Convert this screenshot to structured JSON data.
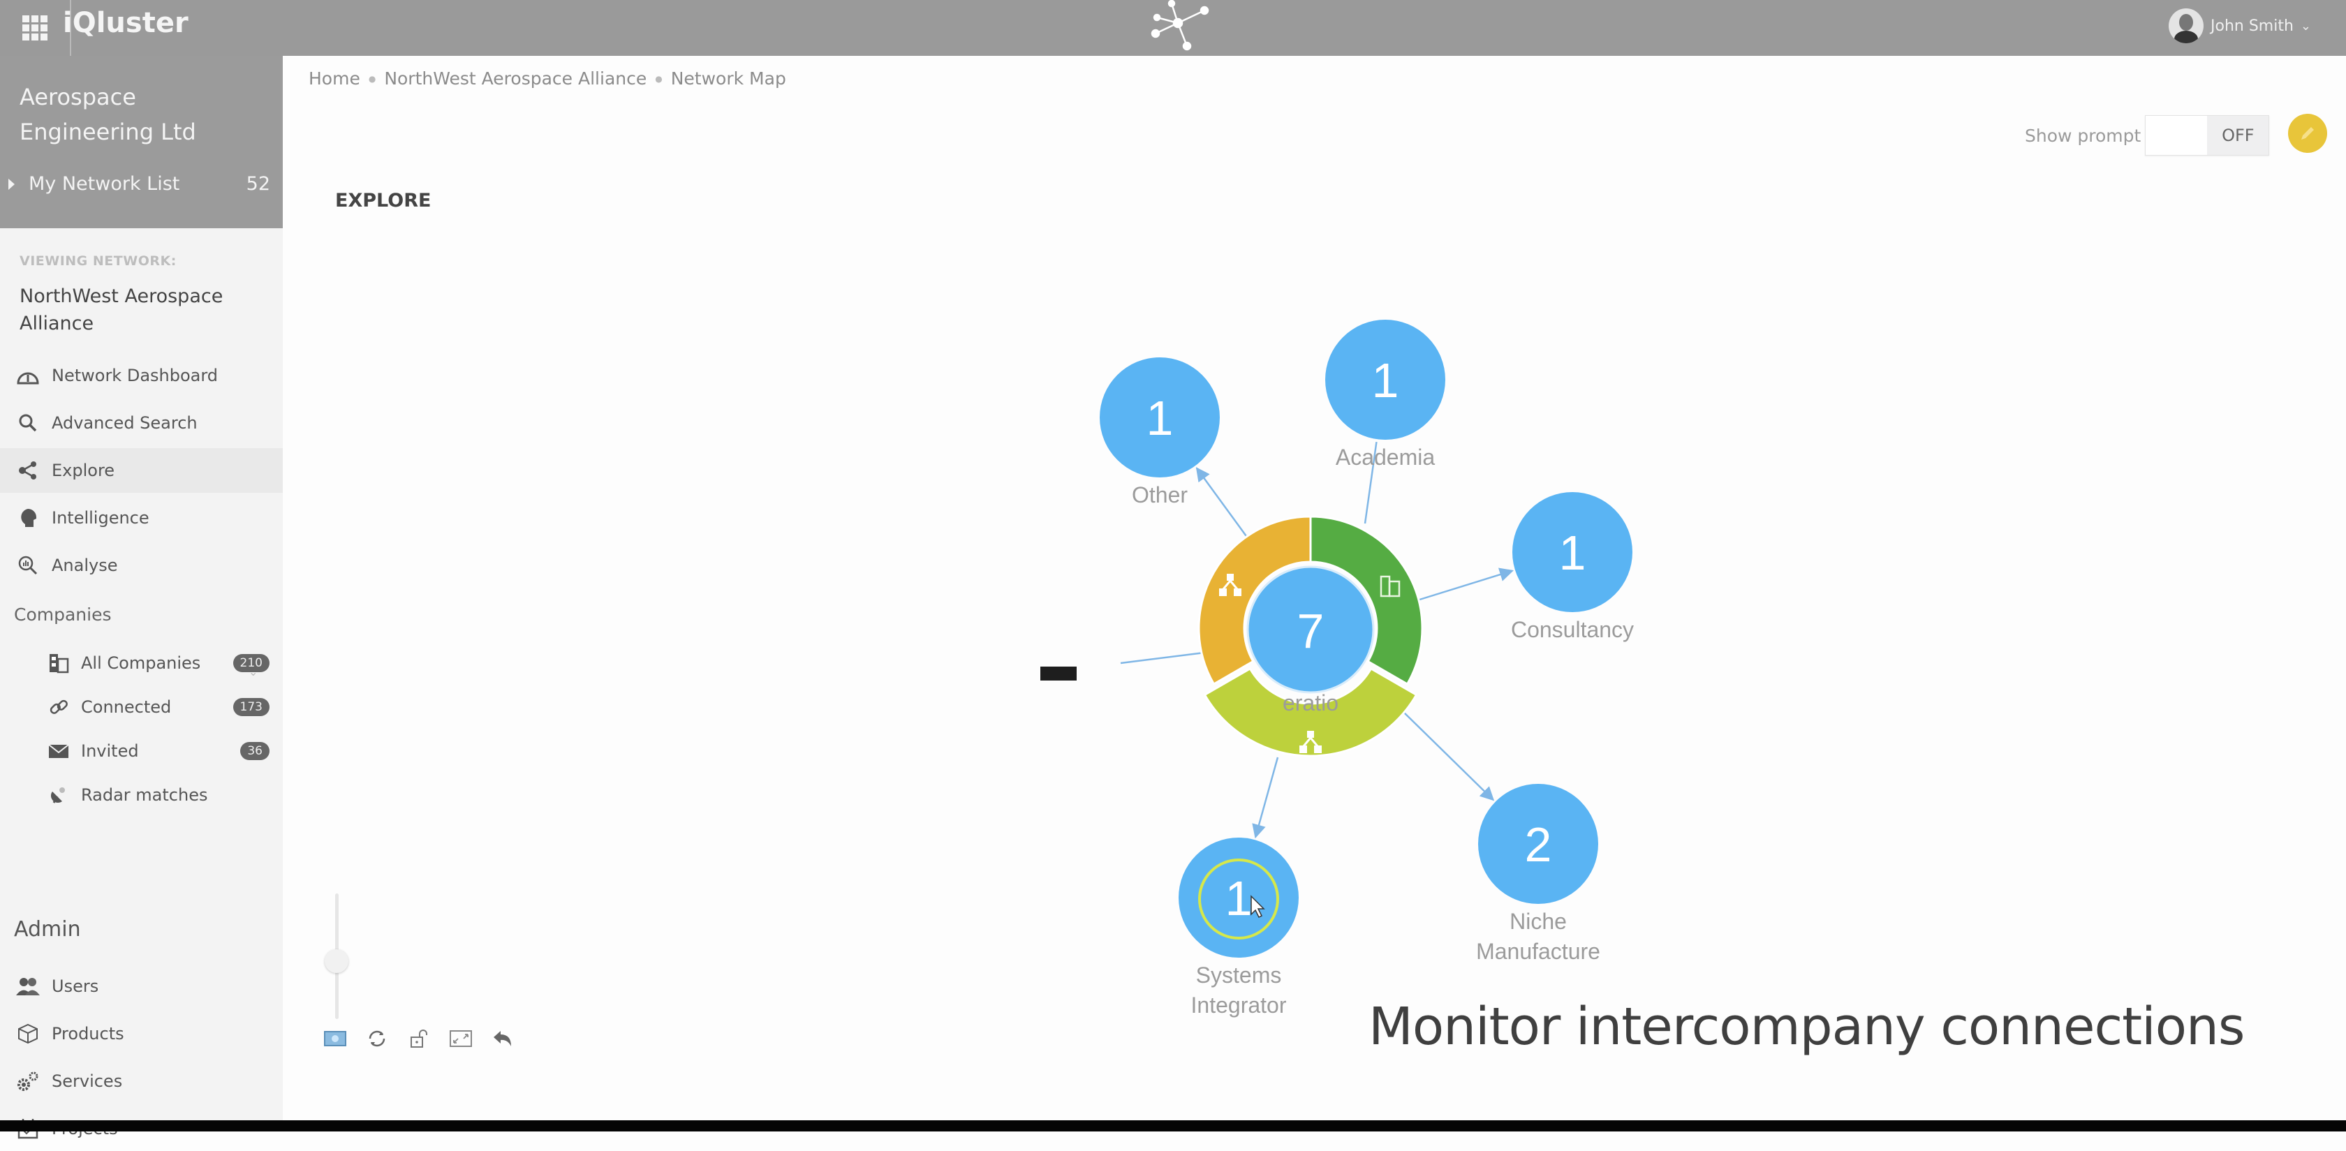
{
  "app": {
    "title": "iQluster",
    "user_name": "John Smith"
  },
  "sidebar": {
    "company": "Aerospace Engineering Ltd",
    "network_list": {
      "label": "My Network List",
      "count": "52"
    },
    "viewing_label": "VIEWING NETWORK:",
    "network_name": "NorthWest Aerospace Alliance",
    "nav": [
      {
        "label": "Network Dashboard",
        "icon": "dashboard-icon"
      },
      {
        "label": "Advanced Search",
        "icon": "search-icon"
      },
      {
        "label": "Explore",
        "icon": "share-icon",
        "active": true
      },
      {
        "label": "Intelligence",
        "icon": "brain-icon"
      },
      {
        "label": "Analyse",
        "icon": "analyse-icon"
      }
    ],
    "companies": {
      "label": "Companies",
      "items": [
        {
          "label": "All Companies",
          "count": "210",
          "icon": "buildings-icon"
        },
        {
          "label": "Connected",
          "count": "173",
          "icon": "link-icon"
        },
        {
          "label": "Invited",
          "count": "36",
          "icon": "envelope-icon"
        },
        {
          "label": "Radar matches",
          "icon": "radar-icon"
        }
      ]
    },
    "admin": {
      "label": "Admin",
      "items": [
        {
          "label": "Users",
          "icon": "users-icon"
        },
        {
          "label": "Products",
          "icon": "box-icon"
        },
        {
          "label": "Services",
          "icon": "gears-icon"
        },
        {
          "label": "Projects",
          "icon": "calendar-icon"
        }
      ]
    }
  },
  "breadcrumb": [
    "Home",
    "NorthWest Aerospace Alliance",
    "Network Map"
  ],
  "page_title": "EXPLORE",
  "prompt": {
    "label": "Show prompt",
    "state": "OFF"
  },
  "network_map": {
    "center": {
      "count": "7",
      "label_fragment": "eratio"
    },
    "ring_segments": [
      {
        "color": "#e8b234",
        "icon": "hierarchy-icon"
      },
      {
        "color": "#55ac43",
        "icon": "buildings-icon"
      },
      {
        "color": "#bdd13c",
        "icon": "hierarchy-icon"
      }
    ],
    "nodes": [
      {
        "label": "Other",
        "count": "1"
      },
      {
        "label": "Academia",
        "count": "1"
      },
      {
        "label": "Consultancy",
        "count": "1"
      },
      {
        "label": "Niche Manufacture",
        "count": "2"
      },
      {
        "label": "Systems Integrator",
        "count": "1",
        "selected": true
      }
    ],
    "node_color": "#5ab4f3",
    "edge_color": "#7fb6e6",
    "zoom_level": 0.45
  },
  "toolbar": [
    {
      "icon": "screenshot-icon"
    },
    {
      "icon": "refresh-icon"
    },
    {
      "icon": "unlock-icon"
    },
    {
      "icon": "fit-screen-icon"
    },
    {
      "icon": "undo-icon"
    }
  ],
  "caption": "Monitor intercompany connections"
}
